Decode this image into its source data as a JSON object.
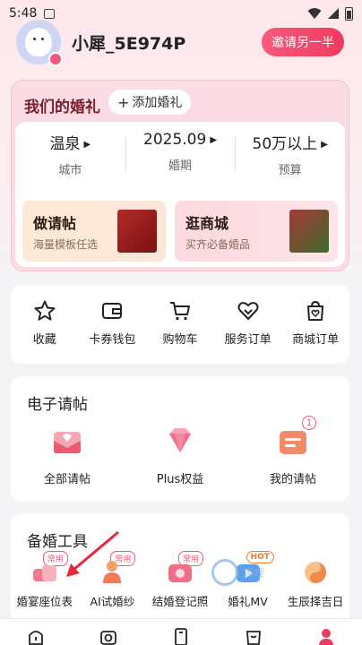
{
  "status_bar": {
    "time": "5:48"
  },
  "profile": {
    "username": "小犀_5E974P",
    "invite_label": "邀请另一半"
  },
  "wedding": {
    "title": "我们的婚礼",
    "add_label": "添加婚礼",
    "stats": [
      {
        "value": "温泉",
        "label": "城市"
      },
      {
        "value": "2025.09",
        "label": "婚期"
      },
      {
        "value": "50万以上",
        "label": "预算"
      }
    ],
    "promos": [
      {
        "title": "做请帖",
        "subtitle": "海量模板任选"
      },
      {
        "title": "逛商城",
        "subtitle": "买齐必备婚品"
      }
    ]
  },
  "quick_menu": [
    {
      "label": "收藏",
      "icon": "star-icon"
    },
    {
      "label": "卡券钱包",
      "icon": "wallet-icon"
    },
    {
      "label": "购物车",
      "icon": "cart-icon"
    },
    {
      "label": "服务订单",
      "icon": "service-order-icon"
    },
    {
      "label": "商城订单",
      "icon": "mall-order-icon"
    }
  ],
  "invitations": {
    "title": "电子请帖",
    "items": [
      {
        "label": "全部请帖",
        "icon": "envelope-icon"
      },
      {
        "label": "Plus权益",
        "icon": "diamond-icon"
      },
      {
        "label": "我的请帖",
        "icon": "my-invitation-icon",
        "badge": "1"
      }
    ]
  },
  "tools": {
    "title": "备婚工具",
    "items": [
      {
        "label": "婚宴座位表",
        "icon": "seat-chart-icon",
        "tag": "常用"
      },
      {
        "label": "AI试婚纱",
        "icon": "ai-dress-icon",
        "tag": "常用"
      },
      {
        "label": "结婚登记照",
        "icon": "registration-photo-icon",
        "tag": "常用"
      },
      {
        "label": "婚礼MV",
        "icon": "wedding-mv-icon",
        "tag": "HOT"
      },
      {
        "label": "生辰择吉日",
        "icon": "auspicious-date-icon"
      }
    ]
  },
  "watermark": {
    "text": "游戏"
  },
  "bottom_nav": [
    "home-icon",
    "camera-icon",
    "phone-icon",
    "shop-icon",
    "mine-icon"
  ],
  "colors": {
    "accent": "#f03a5e",
    "wedding_title": "#7a1f2c",
    "page_bg": "#f4f4f6"
  }
}
